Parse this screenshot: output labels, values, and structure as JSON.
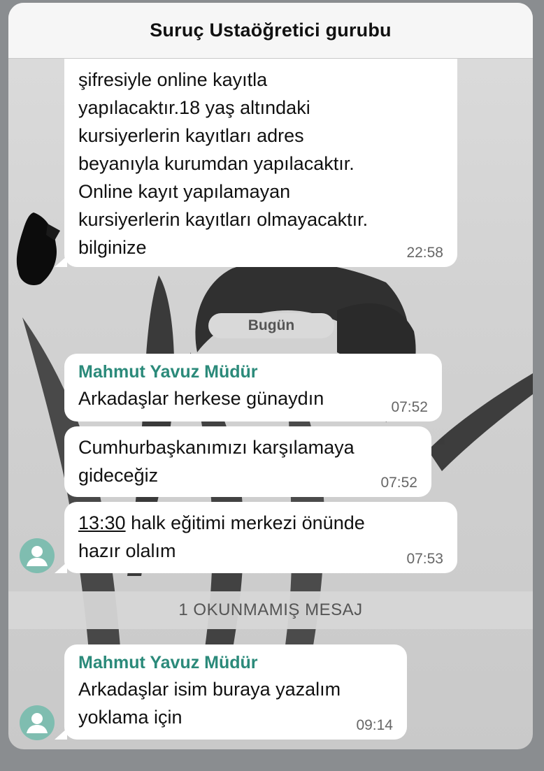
{
  "header": {
    "title": "Suruç Ustaöğretici gurubu"
  },
  "messages": [
    {
      "lines": [
        "şifresiyle online kayıtla",
        "yapılacaktır.18 yaş altındaki",
        "kursiyerlerin  kayıtları adres",
        "beyanıyla kurumdan yapılacaktır.",
        "Online kayıt yapılamayan",
        "kursiyerlerin kayıtları olmayacaktır.",
        "bilginize"
      ],
      "time": "22:58"
    }
  ],
  "date_separator": "Bugün",
  "group1": {
    "sender": "Mahmut Yavuz Müdür",
    "m1": {
      "text": "Arkadaşlar herkese günaydın",
      "time": "07:52"
    },
    "m2": {
      "line1": "Cumhurbaşkanımızı karşılamaya",
      "line2": "gideceğiz",
      "time": "07:52"
    },
    "m3": {
      "link": "13:30",
      "rest": " halk eğitimi merkezi önünde",
      "line2": "hazır olalım",
      "time": "07:53"
    }
  },
  "unread_banner": "1 OKUNMAMIŞ MESAJ",
  "group2": {
    "sender": "Mahmut Yavuz Müdür",
    "line1": "Arkadaşlar isim buraya yazalım",
    "line2": "yoklama için",
    "time": "09:14"
  },
  "colors": {
    "sender": "#2b8a7a",
    "avatar": "#7fbdb0",
    "bubble": "#ffffff"
  },
  "icons": {
    "avatar": "person-silhouette-icon"
  }
}
